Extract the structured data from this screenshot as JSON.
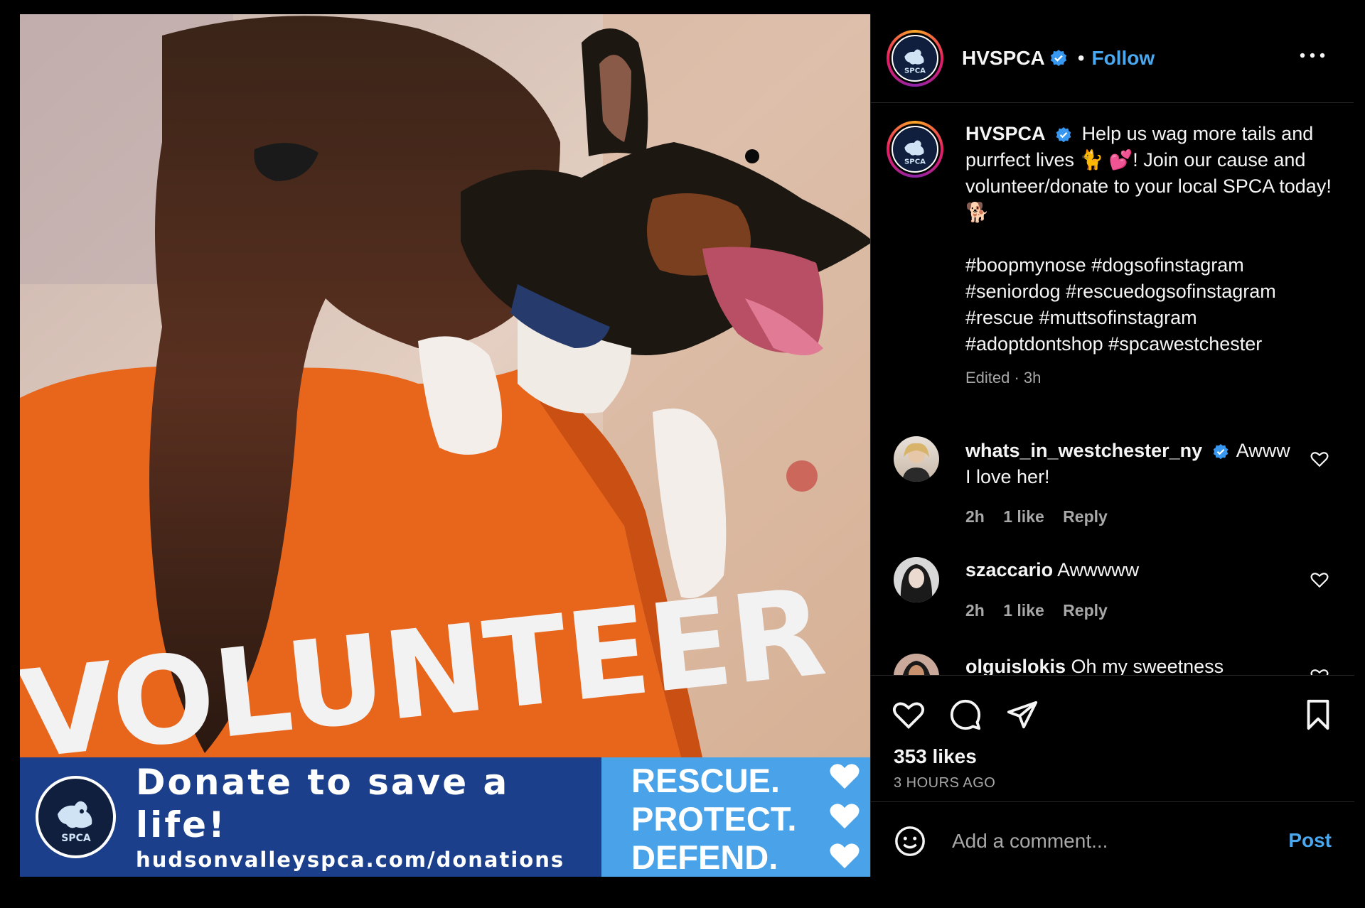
{
  "post": {
    "username": "HVSPCA",
    "verified": true,
    "follow_label": "Follow",
    "header_separator": "•",
    "more_icon": "more-horizontal-icon",
    "caption_text": "Help us wag more tails and purrfect lives 🐈 💕! Join our cause and volunteer/donate to your local SPCA today! 🐕",
    "hashtags": "#boopmynose #dogsofinstagram\n#seniordog #rescuedogsofinstagram\n#rescue #muttsofinstagram\n#adoptdontshop #spcawestchester",
    "caption_meta": "Edited · 3h",
    "likes": "353 likes",
    "time_ago": "3 HOURS AGO"
  },
  "media": {
    "shirt_text": "VOLUNTEER",
    "banner_title": "Donate to save a life!",
    "banner_url": "hudsonvalleyspca.com/donations",
    "logo_text": "SPCA",
    "slogan": [
      "RESCUE.",
      "PROTECT.",
      "DEFEND."
    ],
    "colors": {
      "banner_blue": "#1b3f8a",
      "banner_light_blue": "#4aa3e8",
      "shirt_orange": "#e8651c"
    }
  },
  "comments": [
    {
      "username": "whats_in_westchester_ny",
      "verified": true,
      "text": "Awww I love her!",
      "time": "2h",
      "likes": "1 like",
      "reply": "Reply"
    },
    {
      "username": "szaccario",
      "verified": false,
      "text": "Awwwww",
      "time": "2h",
      "likes": "1 like",
      "reply": "Reply"
    },
    {
      "username": "olguislokis",
      "verified": false,
      "text": "Oh my sweetness",
      "time": "",
      "likes": "",
      "reply": ""
    }
  ],
  "actions": {
    "like_icon": "heart-icon",
    "comment_icon": "comment-icon",
    "share_icon": "send-icon",
    "save_icon": "bookmark-icon"
  },
  "add_comment": {
    "placeholder": "Add a comment...",
    "post_label": "Post",
    "emoji_icon": "emoji-icon"
  },
  "colors": {
    "accent": "#4aa8f0",
    "background": "#000000",
    "muted": "#a8a8a8"
  }
}
